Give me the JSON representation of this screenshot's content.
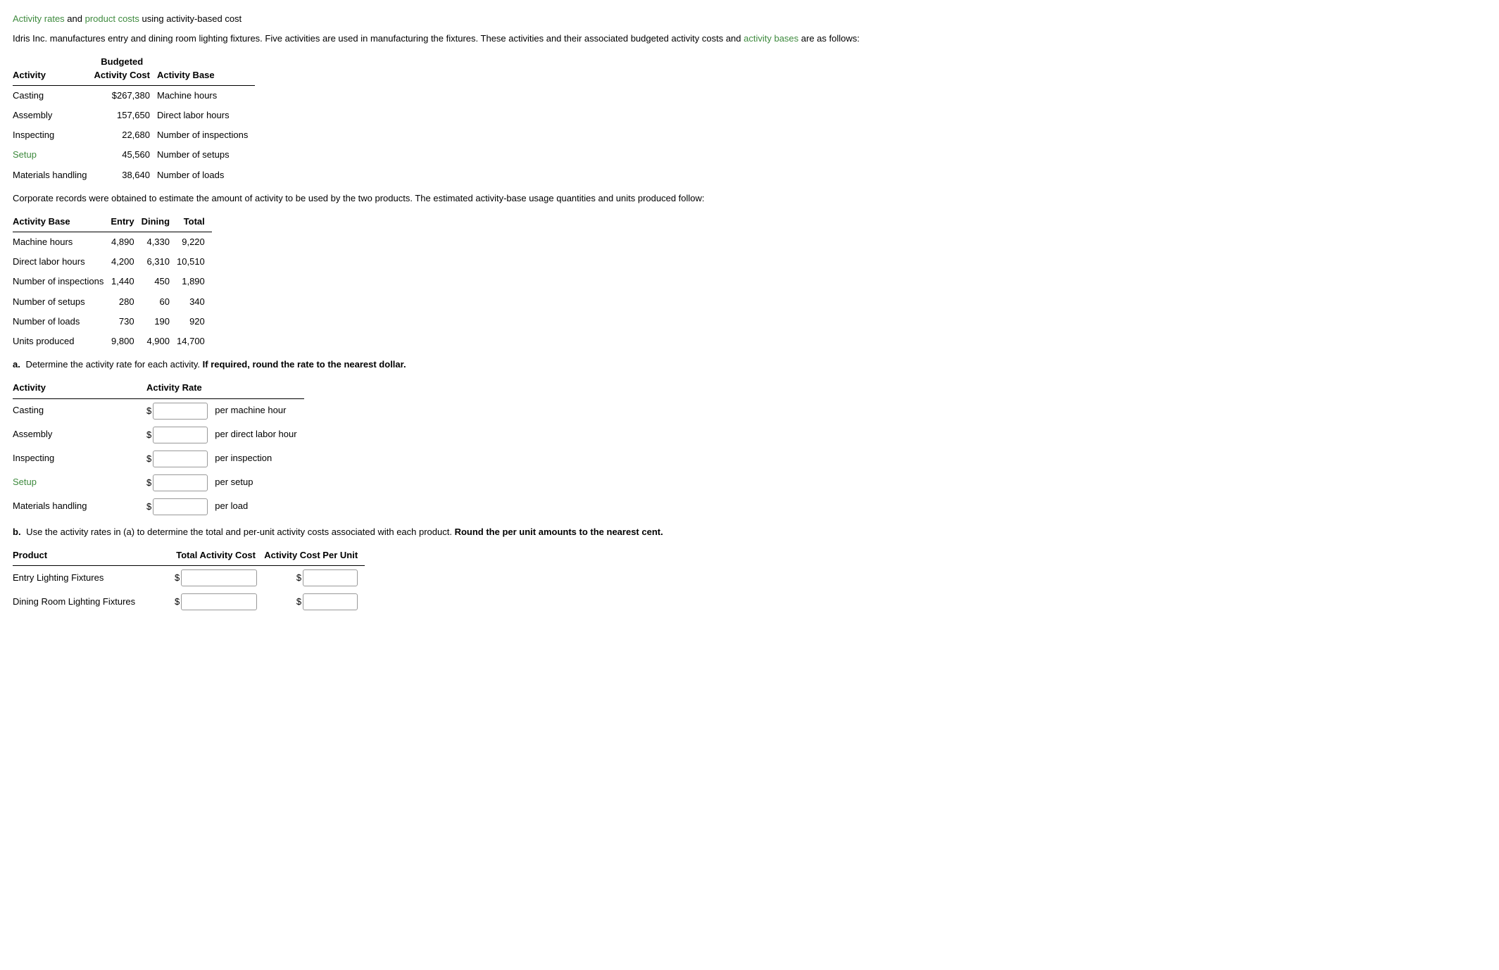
{
  "title_part1": "Activity rates",
  "title_mid1": " and ",
  "title_part2": "product costs",
  "title_rest": " using activity-based cost",
  "intro_a": "Idris Inc. manufactures entry and dining room lighting fixtures. Five activities are used in manufacturing the fixtures. These activities and their associated budgeted activity costs and ",
  "intro_link": "activity bases",
  "intro_b": " are as follows:",
  "table1": {
    "col_activity": "Activity",
    "col_cost_line1": "Budgeted",
    "col_cost_line2": "Activity Cost",
    "col_base": "Activity Base",
    "rows": [
      {
        "activity": "Casting",
        "cost": "$267,380",
        "base": "Machine hours"
      },
      {
        "activity": "Assembly",
        "cost": "157,650",
        "base": "Direct labor hours"
      },
      {
        "activity": "Inspecting",
        "cost": "22,680",
        "base": "Number of inspections"
      },
      {
        "activity": "Setup",
        "cost": "45,560",
        "base": "Number of setups",
        "green": true
      },
      {
        "activity": "Materials handling",
        "cost": "38,640",
        "base": "Number of loads"
      }
    ]
  },
  "mid_text": "Corporate records were obtained to estimate the amount of activity to be used by the two products. The estimated activity-base usage quantities and units produced follow:",
  "table2": {
    "col_base": "Activity Base",
    "col_entry": "Entry",
    "col_dining": "Dining",
    "col_total": "Total",
    "rows": [
      {
        "base": "Machine hours",
        "entry": "4,890",
        "dining": "4,330",
        "total": "9,220"
      },
      {
        "base": "Direct labor hours",
        "entry": "4,200",
        "dining": "6,310",
        "total": "10,510"
      },
      {
        "base": "Number of inspections",
        "entry": "1,440",
        "dining": "450",
        "total": "1,890"
      },
      {
        "base": "Number of setups",
        "entry": "280",
        "dining": "60",
        "total": "340"
      },
      {
        "base": "Number of loads",
        "entry": "730",
        "dining": "190",
        "total": "920"
      },
      {
        "base": "Units produced",
        "entry": "9,800",
        "dining": "4,900",
        "total": "14,700"
      }
    ]
  },
  "qa": {
    "label": "a.",
    "text_a": "  Determine the activity rate for each activity. ",
    "text_bold": "If required, round the rate to the nearest dollar."
  },
  "table3": {
    "col_activity": "Activity",
    "col_rate": "Activity Rate",
    "rows": [
      {
        "activity": "Casting",
        "unit": "per machine hour"
      },
      {
        "activity": "Assembly",
        "unit": "per direct labor hour"
      },
      {
        "activity": "Inspecting",
        "unit": "per inspection"
      },
      {
        "activity": "Setup",
        "unit": "per setup",
        "green": true
      },
      {
        "activity": "Materials handling",
        "unit": "per load"
      }
    ]
  },
  "qb": {
    "label": "b.",
    "text_a": "  Use the activity rates in (a) to determine the total and per-unit activity costs associated with each product. ",
    "text_bold": "Round the per unit amounts to the nearest cent."
  },
  "table4": {
    "col_product": "Product",
    "col_total": "Total Activity Cost",
    "col_perunit": "Activity Cost Per Unit",
    "rows": [
      {
        "product": "Entry Lighting Fixtures"
      },
      {
        "product": "Dining Room Lighting Fixtures"
      }
    ]
  },
  "dollar": "$"
}
